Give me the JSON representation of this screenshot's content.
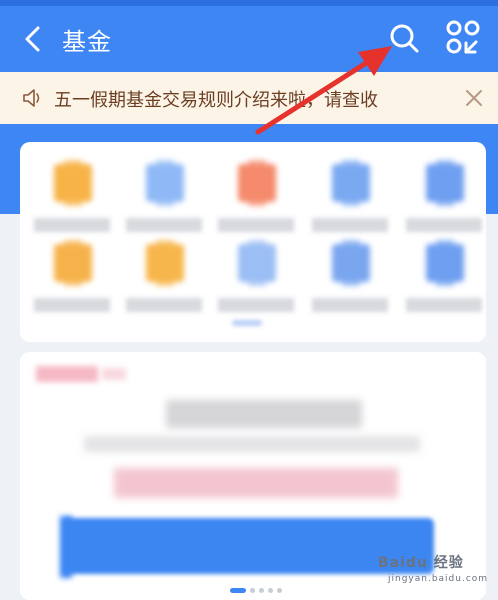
{
  "header": {
    "title": "基金",
    "back_icon": "chevron-left-icon",
    "search_icon": "search-icon",
    "scan_icon": "scan-icon",
    "color": "#3f86f5"
  },
  "notice": {
    "text": "五一假期基金交易规则介绍来啦，请查收",
    "background": "#fdf4e8",
    "text_color": "#6b3e22"
  },
  "entries": [
    {
      "color": "#f7b347"
    },
    {
      "color": "#8fb9f6"
    },
    {
      "color": "#f58a6c"
    },
    {
      "color": "#7aa9f2"
    },
    {
      "color": "#6f9ff0"
    },
    {
      "color": "#f6b24a"
    },
    {
      "color": "#f7b64c"
    },
    {
      "color": "#9bbef4"
    },
    {
      "color": "#7aa6f0"
    },
    {
      "color": "#6e9ff0"
    }
  ],
  "watermark": {
    "brand": "Baidu 经验",
    "url": "jingyan.baidu.com"
  }
}
